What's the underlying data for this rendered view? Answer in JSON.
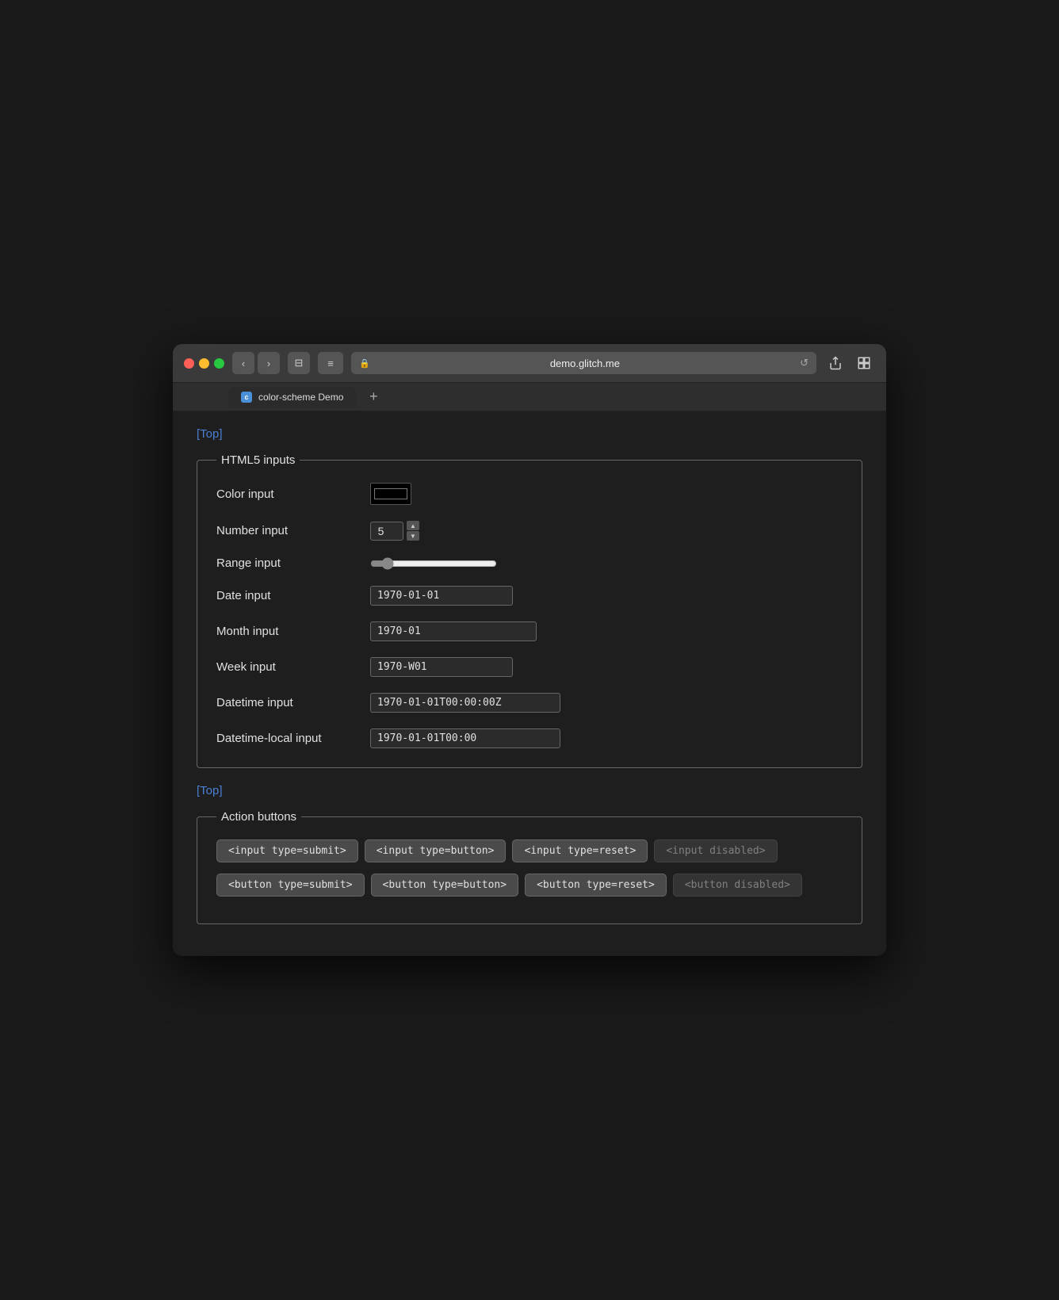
{
  "browser": {
    "url": "demo.glitch.me",
    "tab_label": "color-scheme Demo",
    "tab_favicon_letter": "c"
  },
  "nav": {
    "back": "‹",
    "forward": "›",
    "sidebar": "⊟",
    "menu": "≡",
    "lock": "🔒",
    "reload": "↺",
    "share": "⎙",
    "tabs": "⧉",
    "new_tab": "+"
  },
  "page": {
    "top_link": "[Top]",
    "html5_section": {
      "legend": "HTML5 inputs",
      "color_label": "Color input",
      "color_value": "#000000",
      "number_label": "Number input",
      "number_value": "5",
      "range_label": "Range input",
      "range_value": "10",
      "date_label": "Date input",
      "date_value": "1970-01-01",
      "month_label": "Month input",
      "month_value": "1970-01",
      "week_label": "Week input",
      "week_value": "1970-W01",
      "datetime_label": "Datetime input",
      "datetime_value": "1970-01-01T00:00:00Z",
      "datetime_local_label": "Datetime-local input",
      "datetime_local_value": "1970-01-01T00:00"
    },
    "top_link_2": "[Top]",
    "action_section": {
      "legend": "Action buttons",
      "btn_submit_input": "<input type=submit>",
      "btn_button_input": "<input type=button>",
      "btn_reset_input": "<input type=reset>",
      "btn_disabled_input": "<input disabled>",
      "btn_submit_button": "<button type=submit>",
      "btn_button_button": "<button type=button>",
      "btn_reset_button": "<button type=reset>",
      "btn_disabled_button": "<button disabled>"
    }
  }
}
